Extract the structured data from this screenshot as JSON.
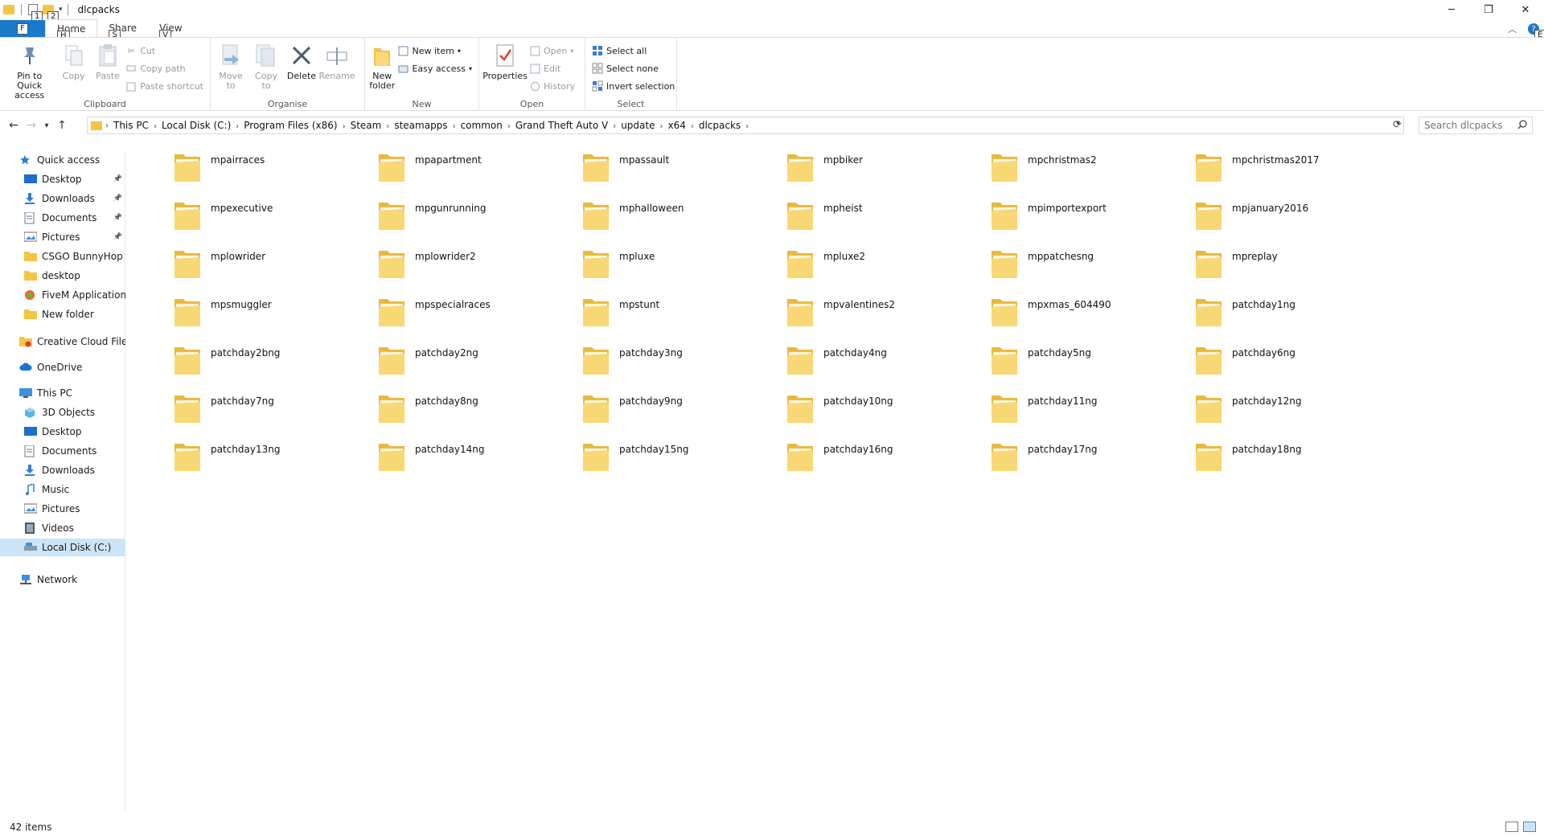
{
  "window": {
    "title": "dlcpacks",
    "controls": [
      "─",
      "❐",
      "✕"
    ],
    "qat_keytips": [
      "1",
      "2"
    ]
  },
  "tabs": {
    "file": {
      "label": "F"
    },
    "items": [
      {
        "label": "Home",
        "keytip": "H"
      },
      {
        "label": "Share",
        "keytip": "S"
      },
      {
        "label": "View",
        "keytip": "V"
      }
    ],
    "expand_glyph": "︿",
    "help_label": "?",
    "help_keytip": "E"
  },
  "ribbon": {
    "clipboard": {
      "label": "Clipboard",
      "pin": "Pin to Quick access",
      "copy": "Copy",
      "paste": "Paste",
      "cut": "Cut",
      "copy_path": "Copy path",
      "paste_shortcut": "Paste shortcut"
    },
    "organise": {
      "label": "Organise",
      "move_to": "Move to",
      "copy_to": "Copy to",
      "delete": "Delete",
      "rename": "Rename"
    },
    "new": {
      "label": "New",
      "new_folder": "New folder",
      "new_item": "New item",
      "easy_access": "Easy access"
    },
    "open": {
      "label": "Open",
      "properties": "Properties",
      "open": "Open",
      "edit": "Edit",
      "history": "History"
    },
    "select": {
      "label": "Select",
      "select_all": "Select all",
      "select_none": "Select none",
      "invert": "Invert selection"
    }
  },
  "address": {
    "crumbs": [
      "This PC",
      "Local Disk (C:)",
      "Program Files (x86)",
      "Steam",
      "steamapps",
      "common",
      "Grand Theft Auto V",
      "update",
      "x64",
      "dlcpacks"
    ],
    "search_placeholder": "Search dlcpacks"
  },
  "nav": {
    "quick_access": "Quick access",
    "quick_items": [
      {
        "label": "Desktop",
        "pinned": true,
        "icon": "desktop"
      },
      {
        "label": "Downloads",
        "pinned": true,
        "icon": "download"
      },
      {
        "label": "Documents",
        "pinned": true,
        "icon": "document"
      },
      {
        "label": "Pictures",
        "pinned": true,
        "icon": "picture"
      },
      {
        "label": "CSGO BunnyHop Sc",
        "pinned": false,
        "icon": "folder"
      },
      {
        "label": "desktop",
        "pinned": false,
        "icon": "folder"
      },
      {
        "label": "FiveM Application D",
        "pinned": false,
        "icon": "fivem"
      },
      {
        "label": "New folder",
        "pinned": false,
        "icon": "folder"
      }
    ],
    "creative_cloud": "Creative Cloud Files",
    "onedrive": "OneDrive",
    "this_pc": "This PC",
    "pc_items": [
      {
        "label": "3D Objects",
        "icon": "cube"
      },
      {
        "label": "Desktop",
        "icon": "desktop"
      },
      {
        "label": "Documents",
        "icon": "document"
      },
      {
        "label": "Downloads",
        "icon": "download"
      },
      {
        "label": "Music",
        "icon": "music"
      },
      {
        "label": "Pictures",
        "icon": "picture"
      },
      {
        "label": "Videos",
        "icon": "video"
      },
      {
        "label": "Local Disk (C:)",
        "icon": "disk"
      }
    ],
    "network": "Network"
  },
  "folders": [
    "mpairraces",
    "mpapartment",
    "mpassault",
    "mpbiker",
    "mpchristmas2",
    "mpchristmas2017",
    "mpexecutive",
    "mpgunrunning",
    "mphalloween",
    "mpheist",
    "mpimportexport",
    "mpjanuary2016",
    "mplowrider",
    "mplowrider2",
    "mpluxe",
    "mpluxe2",
    "mppatchesng",
    "mpreplay",
    "mpsmuggler",
    "mpspecialraces",
    "mpstunt",
    "mpvalentines2",
    "mpxmas_604490",
    "patchday1ng",
    "patchday2bng",
    "patchday2ng",
    "patchday3ng",
    "patchday4ng",
    "patchday5ng",
    "patchday6ng",
    "patchday7ng",
    "patchday8ng",
    "patchday9ng",
    "patchday10ng",
    "patchday11ng",
    "patchday12ng",
    "patchday13ng",
    "patchday14ng",
    "patchday15ng",
    "patchday16ng",
    "patchday17ng",
    "patchday18ng"
  ],
  "status": {
    "item_count": "42 items"
  },
  "colors": {
    "accent": "#1979ca",
    "folder": "#f4c542",
    "selected": "#cce4f7"
  }
}
